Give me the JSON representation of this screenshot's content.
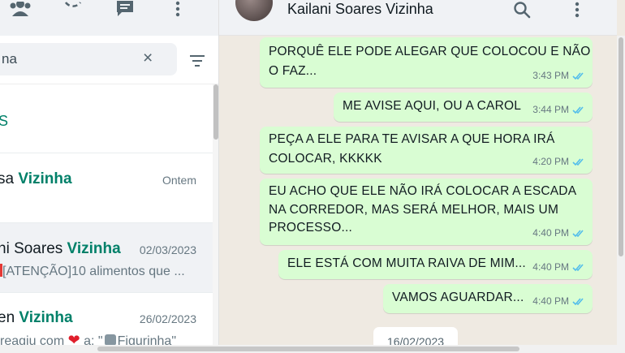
{
  "left_header": {
    "icons": [
      "community-icon",
      "status-icon",
      "new-chat-icon",
      "menu-icon"
    ]
  },
  "search": {
    "value": "na",
    "clear_symbol": "×"
  },
  "archived": {
    "label": "S"
  },
  "chats": [
    {
      "name_prefix": "sa ",
      "name_highlight": "Vizinha",
      "time": "Ontem",
      "preview": ""
    },
    {
      "name_prefix": "ni Soares ",
      "name_highlight": "Vizinha",
      "time": "02/03/2023",
      "preview": "[ATENÇÃO]10 alimentos que ..."
    },
    {
      "name_prefix": "en ",
      "name_highlight": "Vizinha",
      "time": "26/02/2023",
      "preview_before": "reagiu com ",
      "preview_heart": "❤",
      "preview_mid": " a: \"",
      "preview_after": "Figurinha\""
    }
  ],
  "conversation": {
    "contact_name": "Kailani Soares Vizinha",
    "messages": [
      {
        "lines": [
          "PORQUÊ ELE PODE ALEGAR QUE COLOCOU E NÃO",
          "O FAZ..."
        ],
        "time": "3:43 PM"
      },
      {
        "lines": [
          "ME AVISE AQUI, OU A CAROL"
        ],
        "time": "3:44 PM"
      },
      {
        "lines": [
          "PEÇA A ELE PARA TE AVISAR A QUE HORA IRÁ",
          "COLOCAR, KKKKK"
        ],
        "time": "4:20 PM"
      },
      {
        "lines": [
          "EU ACHO QUE ELE NÃO IRÁ COLOCAR A ESCADA",
          "NA CORREDOR, MAS SERÁ MELHOR, MAIS UM",
          "PROCESSO..."
        ],
        "time": "4:40 PM"
      },
      {
        "lines": [
          "ELE ESTÁ COM MUITA RAIVA DE MIM..."
        ],
        "time": "4:40 PM"
      },
      {
        "lines": [
          "VAMOS AGUARDAR..."
        ],
        "time": "4:40 PM"
      }
    ],
    "date_chip": "16/02/2023"
  },
  "colors": {
    "accent": "#008069",
    "outgoing_bubble": "#d9fdd3",
    "chat_background": "#efeae2",
    "read_ticks": "#53bdeb"
  }
}
